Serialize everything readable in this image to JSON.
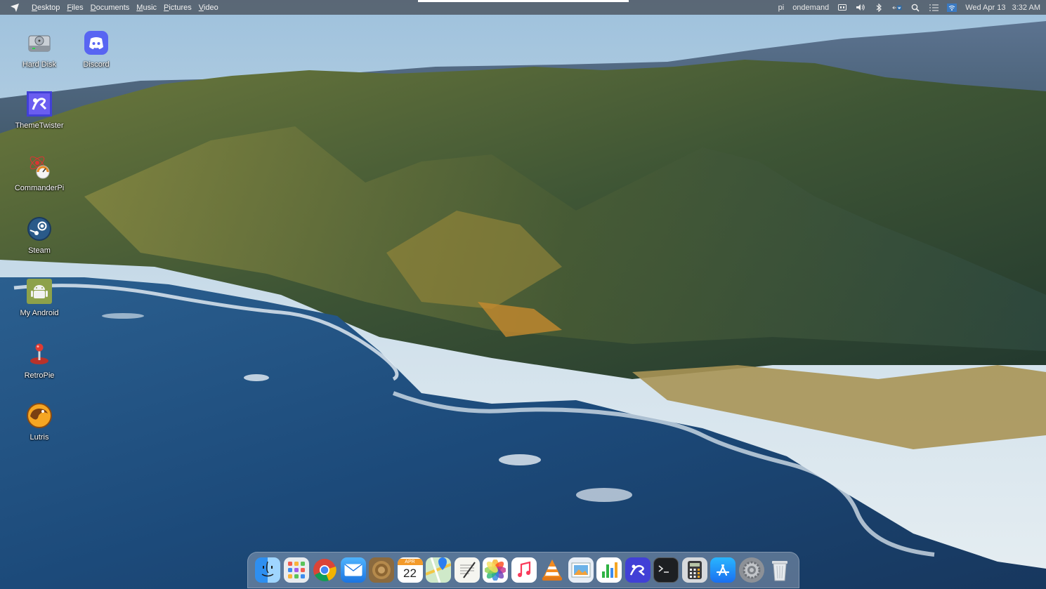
{
  "menubar": {
    "menus": [
      "Desktop",
      "Files",
      "Documents",
      "Music",
      "Pictures",
      "Video"
    ],
    "user": "pi",
    "governor": "ondemand",
    "datetime": "Wed Apr 13   3:32 AM",
    "tray_icons": [
      "cpu-icon",
      "volume-icon",
      "bluetooth-icon",
      "network-icon",
      "search-icon",
      "list-icon",
      "wifi-icon"
    ]
  },
  "desktop_icons": [
    {
      "label": "Hard Disk",
      "icon": "hard-disk-icon"
    },
    {
      "label": "Discord",
      "icon": "discord-icon"
    },
    {
      "label": "ThemeTwister",
      "icon": "themetwister-icon"
    },
    {
      "label": "CommanderPi",
      "icon": "commanderpi-icon"
    },
    {
      "label": "Steam",
      "icon": "steam-icon"
    },
    {
      "label": "My Android",
      "icon": "android-icon"
    },
    {
      "label": "RetroPie",
      "icon": "retropie-icon"
    },
    {
      "label": "Lutris",
      "icon": "lutris-icon"
    }
  ],
  "dock": {
    "calendar_month": "APR",
    "calendar_day": "22",
    "apps": [
      "finder-icon",
      "launchpad-icon",
      "chrome-icon",
      "mail-icon",
      "photos-archive-icon",
      "calendar-icon",
      "maps-icon",
      "textedit-icon",
      "photos-icon",
      "music-icon",
      "vlc-icon",
      "preview-icon",
      "numbers-icon",
      "themetwister-icon",
      "terminal-icon",
      "calculator-icon",
      "app-store-icon",
      "system-preferences-icon",
      "trash-icon"
    ]
  },
  "colors": {
    "menubar_bg": "#464e5a",
    "sky": "#c9dcea",
    "ocean": "#1f4c7c",
    "mountain_dark": "#2d4535",
    "mountain_light": "#8a8a45"
  }
}
